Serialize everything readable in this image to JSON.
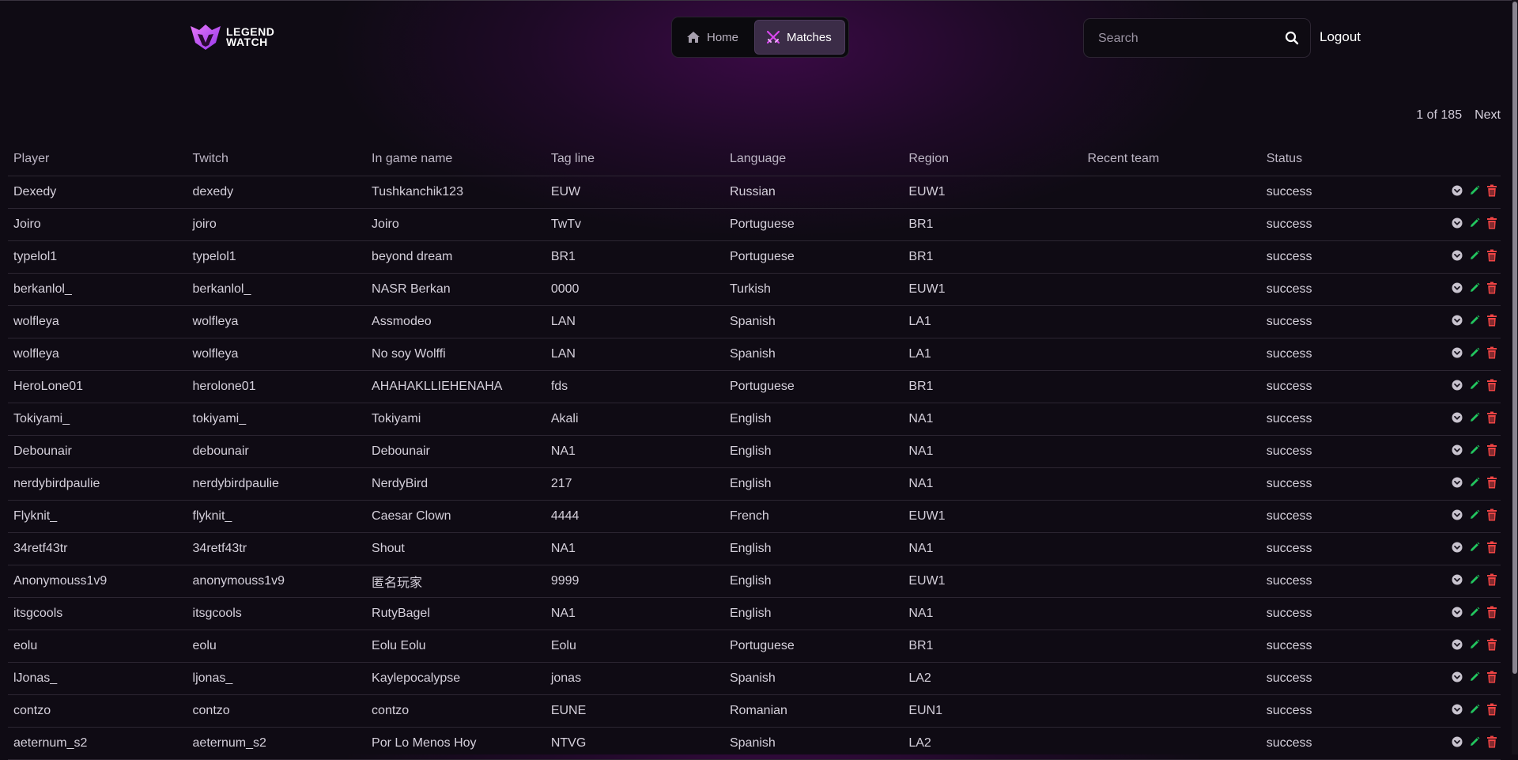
{
  "brand": {
    "line1": "LEGEND",
    "line2": "WATCH"
  },
  "nav": [
    {
      "label": "Home",
      "icon": "home-icon",
      "active": false
    },
    {
      "label": "Matches",
      "icon": "crossed-swords-icon",
      "active": true
    }
  ],
  "search": {
    "placeholder": "Search",
    "value": ""
  },
  "logout_label": "Logout",
  "pager": {
    "count": "1 of 185",
    "next": "Next"
  },
  "colors": {
    "edit": "#22c55e",
    "delete": "#ef4444",
    "accent": "#c026d3"
  },
  "table": {
    "columns": [
      "Player",
      "Twitch",
      "In game name",
      "Tag line",
      "Language",
      "Region",
      "Recent team",
      "Status"
    ],
    "rows": [
      [
        "Dexedy",
        "dexedy",
        "Tushkanchik123",
        "EUW",
        "Russian",
        "EUW1",
        "",
        "success"
      ],
      [
        "Joiro",
        "joiro",
        "Joiro",
        "TwTv",
        "Portuguese",
        "BR1",
        "",
        "success"
      ],
      [
        "typelol1",
        "typelol1",
        "beyond dream",
        "BR1",
        "Portuguese",
        "BR1",
        "",
        "success"
      ],
      [
        "berkanlol_",
        "berkanlol_",
        "NASR Berkan",
        "0000",
        "Turkish",
        "EUW1",
        "",
        "success"
      ],
      [
        "wolfleya",
        "wolfleya",
        "Assmodeo",
        "LAN",
        "Spanish",
        "LA1",
        "",
        "success"
      ],
      [
        "wolfleya",
        "wolfleya",
        "No soy Wolffi",
        "LAN",
        "Spanish",
        "LA1",
        "",
        "success"
      ],
      [
        "HeroLone01",
        "herolone01",
        "AHAHAKLLIEHENAHA",
        "fds",
        "Portuguese",
        "BR1",
        "",
        "success"
      ],
      [
        "Tokiyami_",
        "tokiyami_",
        "Tokiyami",
        "Akali",
        "English",
        "NA1",
        "",
        "success"
      ],
      [
        "Debounair",
        "debounair",
        "Debounair",
        "NA1",
        "English",
        "NA1",
        "",
        "success"
      ],
      [
        "nerdybirdpaulie",
        "nerdybirdpaulie",
        "NerdyBird",
        "217",
        "English",
        "NA1",
        "",
        "success"
      ],
      [
        "Flyknit_",
        "flyknit_",
        "Caesar Clown",
        "4444",
        "French",
        "EUW1",
        "",
        "success"
      ],
      [
        "34retf43tr",
        "34retf43tr",
        "Shout",
        "NA1",
        "English",
        "NA1",
        "",
        "success"
      ],
      [
        "Anonymouss1v9",
        "anonymouss1v9",
        "匿名玩家",
        "9999",
        "English",
        "EUW1",
        "",
        "success"
      ],
      [
        "itsgcools",
        "itsgcools",
        "RutyBagel",
        "NA1",
        "English",
        "NA1",
        "",
        "success"
      ],
      [
        "eolu",
        "eolu",
        "Eolu Eolu",
        "Eolu",
        "Portuguese",
        "BR1",
        "",
        "success"
      ],
      [
        "lJonas_",
        "ljonas_",
        "Kaylepocalypse",
        "jonas",
        "Spanish",
        "LA2",
        "",
        "success"
      ],
      [
        "contzo",
        "contzo",
        "contzo",
        "EUNE",
        "Romanian",
        "EUN1",
        "",
        "success"
      ],
      [
        "aeternum_s2",
        "aeternum_s2",
        "Por Lo Menos Hoy",
        "NTVG",
        "Spanish",
        "LA2",
        "",
        "success"
      ]
    ]
  }
}
